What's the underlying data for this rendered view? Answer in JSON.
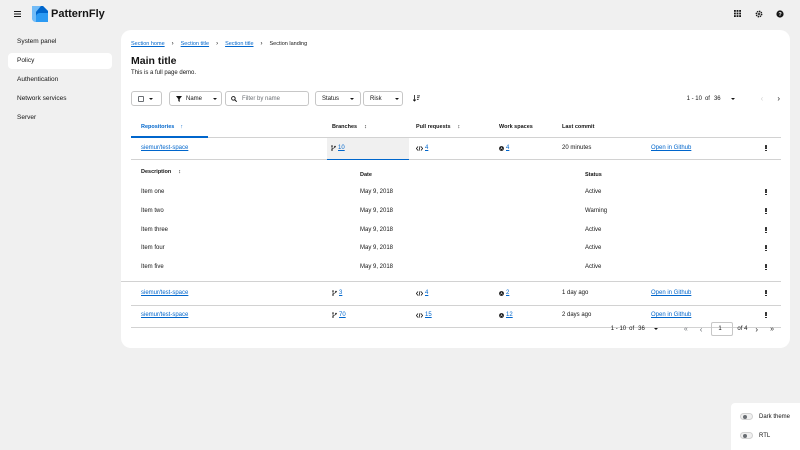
{
  "app": {
    "brand": "PatternFly"
  },
  "sidebar": {
    "items": [
      {
        "label": "System panel"
      },
      {
        "label": "Policy"
      },
      {
        "label": "Authentication"
      },
      {
        "label": "Network services"
      },
      {
        "label": "Server"
      }
    ]
  },
  "breadcrumb": {
    "items": [
      "Section home",
      "Section title",
      "Section title",
      "Section landing"
    ]
  },
  "page": {
    "title": "Main title",
    "description": "This is a full page demo."
  },
  "toolbar": {
    "name_label": "Name",
    "filter_placeholder": "Filter by name",
    "status_label": "Status",
    "risk_label": "Risk"
  },
  "pagination_top": {
    "range": "1 - 10",
    "of": "of",
    "total": "36"
  },
  "table": {
    "headers": {
      "repositories": "Repositories",
      "branches": "Branches",
      "pull_requests": "Pull requests",
      "work_spaces": "Work spaces",
      "last_commit": "Last commit"
    },
    "rows": [
      {
        "repo": "siemur/test-space",
        "branches": "10",
        "prs": "4",
        "workspaces": "4",
        "last_commit": "20 minutes",
        "action": "Open in Github"
      },
      {
        "repo": "siemur/test-space",
        "branches": "3",
        "prs": "4",
        "workspaces": "2",
        "last_commit": "1 day ago",
        "action": "Open in Github"
      },
      {
        "repo": "siemur/test-space",
        "branches": "70",
        "prs": "15",
        "workspaces": "12",
        "last_commit": "2 days ago",
        "action": "Open in Github"
      }
    ],
    "nested": {
      "headers": {
        "description": "Description",
        "date": "Date",
        "status": "Status"
      },
      "rows": [
        {
          "description": "Item one",
          "date": "May 9, 2018",
          "status": "Active"
        },
        {
          "description": "Item two",
          "date": "May 9, 2018",
          "status": "Warning"
        },
        {
          "description": "Item three",
          "date": "May 9, 2018",
          "status": "Active"
        },
        {
          "description": "Item four",
          "date": "May 9, 2018",
          "status": "Active"
        },
        {
          "description": "Item five",
          "date": "May 9, 2018",
          "status": "Active"
        }
      ]
    }
  },
  "pagination_bottom": {
    "range": "1 - 10",
    "of": "of",
    "total": "36",
    "page": "1",
    "of_pages": "of 4"
  },
  "theme_panel": {
    "dark_theme": "Dark theme",
    "rtl": "RTL"
  },
  "colors": {
    "link": "#0066cc",
    "active_nav_bg": "#ffffff",
    "page_bg": "#f0f0f0"
  }
}
